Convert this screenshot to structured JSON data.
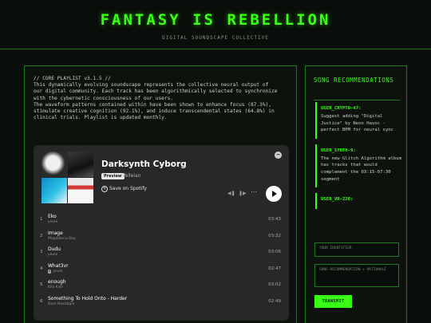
{
  "header": {
    "title": "FANTASY IS REBELLION",
    "subtitle": "DIGITAL SOUNDSCAPE COLLECTIVE"
  },
  "playlist": {
    "version_line": "// CORE PLAYLIST v3.1.5 //",
    "description_lines": [
      "This dynamically evolving soundscape represents the collective neural output of",
      "our digital community. Each track has been algorithmically selected to synchronize",
      "with the cybernetic consciousness of our users.",
      "The waveform patterns contained within have been shown to enhance focus (87.3%),",
      "stimulate creative cognition (92.1%), and induce transcendental states (64.8%) in",
      "clinical trials. Playlist is updated monthly."
    ]
  },
  "spotify": {
    "playlist_title": "Darksynth Cyborg",
    "preview_badge": "Preview",
    "owner": "Velleian",
    "save_label": "Save on Spotify",
    "tracks": [
      {
        "num": "1",
        "name": "Eko",
        "artist": "yeule",
        "explicit": false,
        "duration": "03:43"
      },
      {
        "num": "2",
        "name": "Image",
        "artist": "Magdalena Bay",
        "explicit": false,
        "duration": "03:32"
      },
      {
        "num": "3",
        "name": "Dudu",
        "artist": "yeule",
        "explicit": false,
        "duration": "03:06"
      },
      {
        "num": "4",
        "name": "What3vr",
        "artist": "yeule",
        "explicit": true,
        "explicit_label": "E",
        "duration": "02:47"
      },
      {
        "num": "5",
        "name": "enough",
        "artist": "Kilo Kish",
        "explicit": false,
        "duration": "03:02"
      },
      {
        "num": "6",
        "name": "Something To Hold Onto - Harder",
        "artist": "Dark Nostalgia",
        "explicit": false,
        "duration": "02:49"
      }
    ]
  },
  "sidebar": {
    "title": "SONG RECOMMENDATIONS",
    "recommendations": [
      {
        "user": "USER_CRYPTO-47:",
        "text": "Suggest adding \"Digital Justice\" by Neon Havoc - perfect BPM for neural sync"
      },
      {
        "user": "USER_SYNTH-9:",
        "text": "The new Glitch Algorithm album has tracks that would complement the 03:15-07:30 segment"
      },
      {
        "user": "USER_VR-228:",
        "text": ""
      }
    ],
    "identifier_placeholder": "YOUR IDENTIFIER",
    "recommendation_placeholder": "SONG RECOMMENDATION + RATIONALE",
    "submit_label": "TRANSMIT"
  },
  "colors": {
    "accent": "#39ff14",
    "border": "#1f7a1f",
    "background": "#0b0f0b",
    "spotify_card": "#282828"
  }
}
